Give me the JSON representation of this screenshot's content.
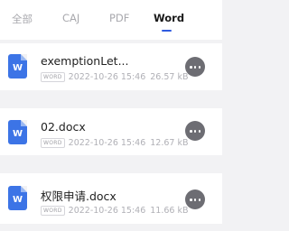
{
  "tabs": [
    {
      "label": "全部",
      "active": false
    },
    {
      "label": "CAJ",
      "active": false
    },
    {
      "label": "PDF",
      "active": false
    },
    {
      "label": "Word",
      "active": true
    }
  ],
  "files": [
    {
      "name": "exemptionLet...",
      "type": "WORD",
      "date": "2022-10-26 15:46",
      "size": "26.57 kB",
      "icon_letter": "W"
    },
    {
      "name": "02.docx",
      "type": "WORD",
      "date": "2022-10-26 15:46",
      "size": "12.67 kB",
      "icon_letter": "W"
    },
    {
      "name": "权限申请.docx",
      "type": "WORD",
      "date": "2022-10-26 15:46",
      "size": "11.66 kB",
      "icon_letter": "W"
    }
  ],
  "colors": {
    "accent": "#2f5be0",
    "word_icon": "#3c74e6",
    "more_button": "#6d6d73",
    "background": "#f2f2f4"
  },
  "icons": {
    "file": "word-file-icon",
    "more": "more-icon"
  }
}
